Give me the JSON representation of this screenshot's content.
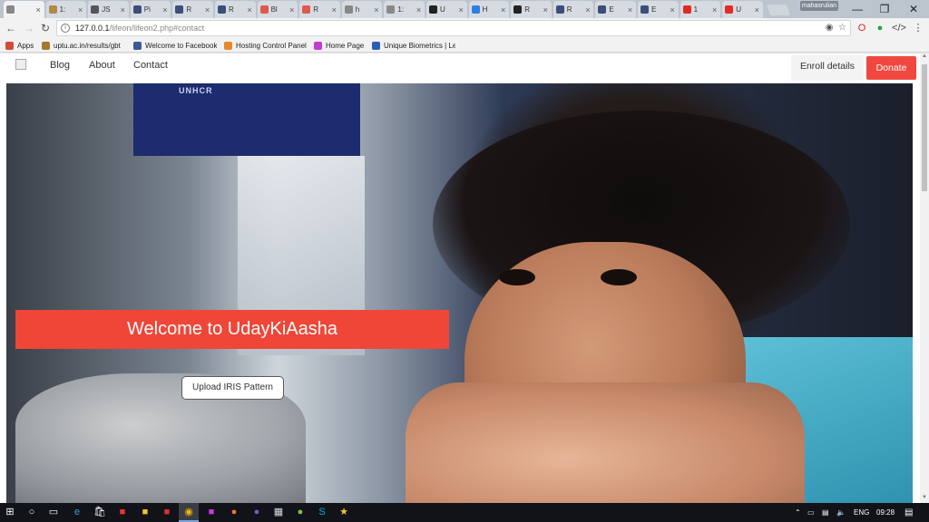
{
  "browser": {
    "tabs": [
      {
        "title": "",
        "icon": "page-icon",
        "color": "#888888",
        "active": true
      },
      {
        "title": "1:",
        "icon": "page-icon",
        "color": "#b08a4b"
      },
      {
        "title": "JS",
        "icon": "brackets-icon",
        "color": "#555555"
      },
      {
        "title": "Pi",
        "icon": "h-logo-icon",
        "color": "#3d4e7a"
      },
      {
        "title": "R",
        "icon": "h-logo-icon",
        "color": "#3d4e7a"
      },
      {
        "title": "R",
        "icon": "h-logo-icon",
        "color": "#3d4e7a"
      },
      {
        "title": "Bl",
        "icon": "pdf-icon",
        "color": "#e2584c"
      },
      {
        "title": "R",
        "icon": "pdf-icon",
        "color": "#e2584c"
      },
      {
        "title": "h",
        "icon": "page-icon",
        "color": "#888888"
      },
      {
        "title": "1:",
        "icon": "page-icon",
        "color": "#888888"
      },
      {
        "title": "U",
        "icon": "github-icon",
        "color": "#222222"
      },
      {
        "title": "H",
        "icon": "dropbox-icon",
        "color": "#2e7fe0"
      },
      {
        "title": "R",
        "icon": "github-icon",
        "color": "#222222"
      },
      {
        "title": "R",
        "icon": "h-logo-icon",
        "color": "#3d4e7a"
      },
      {
        "title": "E",
        "icon": "h-logo-icon",
        "color": "#3d4e7a"
      },
      {
        "title": "E",
        "icon": "h-logo-icon",
        "color": "#3d4e7a"
      },
      {
        "title": "1",
        "icon": "youtube-icon",
        "color": "#e22b24"
      },
      {
        "title": "U",
        "icon": "youtube-icon",
        "color": "#e22b24"
      }
    ],
    "user_chip": "mahasrulian",
    "url_host": "127.0.0.1",
    "url_path": "/lifeon/lifeon2.php#contact",
    "bookmarks": [
      {
        "label": "Apps",
        "icon": "apps-grid-icon",
        "color": "#d24a3a"
      },
      {
        "label": "uptu.ac.in/results/gbt",
        "icon": "globe-icon",
        "color": "#a27a2c"
      },
      {
        "label": "Welcome to Facebook",
        "icon": "facebook-icon",
        "color": "#3b5998"
      },
      {
        "label": "Hosting Control Panel",
        "icon": "cpanel-icon",
        "color": "#e8882c"
      },
      {
        "label": "Home Page",
        "icon": "home-page-icon",
        "color": "#c43bd1"
      },
      {
        "label": "Unique Biometrics | Le",
        "icon": "biometrics-icon",
        "color": "#2a5fb5"
      }
    ]
  },
  "site": {
    "nav_links": [
      "Blog",
      "About",
      "Contact"
    ],
    "enroll_label": "Enroll details",
    "donate_label": "Donate",
    "sign_text": "UNHCR",
    "hero_title": "Welcome to UdayKiAasha",
    "upload_label": "Upload IRIS Pattern",
    "accent_color": "#ef4638"
  },
  "taskbar": {
    "language": "ENG",
    "time": "09:28"
  }
}
